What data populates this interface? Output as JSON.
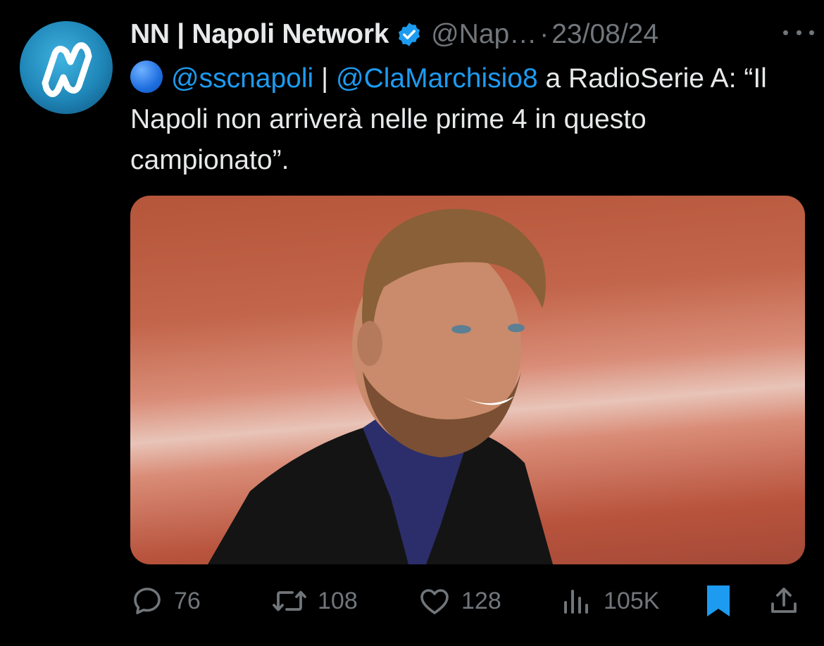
{
  "tweet": {
    "author_name": "NN | Napoli Network",
    "handle": "@Nap…",
    "separator": "·",
    "date": "23/08/24",
    "text_prefix_emoji": "blue-circle-emoji",
    "mention_1": "@sscnapoli",
    "pipe": " | ",
    "mention_2": "@ClaMarchisio8",
    "text_body": " a RadioSerie A: “Il Napoli non arriverà nelle prime 4 in questo campionato”.",
    "colors": {
      "mention": "#1d9bf0",
      "muted": "#71767b",
      "text": "#e7e9ea",
      "verified": "#1d9bf0",
      "bookmark": "#1d9bf0"
    }
  },
  "actions": {
    "replies": {
      "icon": "reply-icon",
      "count": "76"
    },
    "reposts": {
      "icon": "repost-icon",
      "count": "108"
    },
    "likes": {
      "icon": "heart-icon",
      "count": "128"
    },
    "views": {
      "icon": "views-icon",
      "count": "105K"
    },
    "bookmark": {
      "icon": "bookmark-icon"
    },
    "share": {
      "icon": "share-icon"
    }
  }
}
